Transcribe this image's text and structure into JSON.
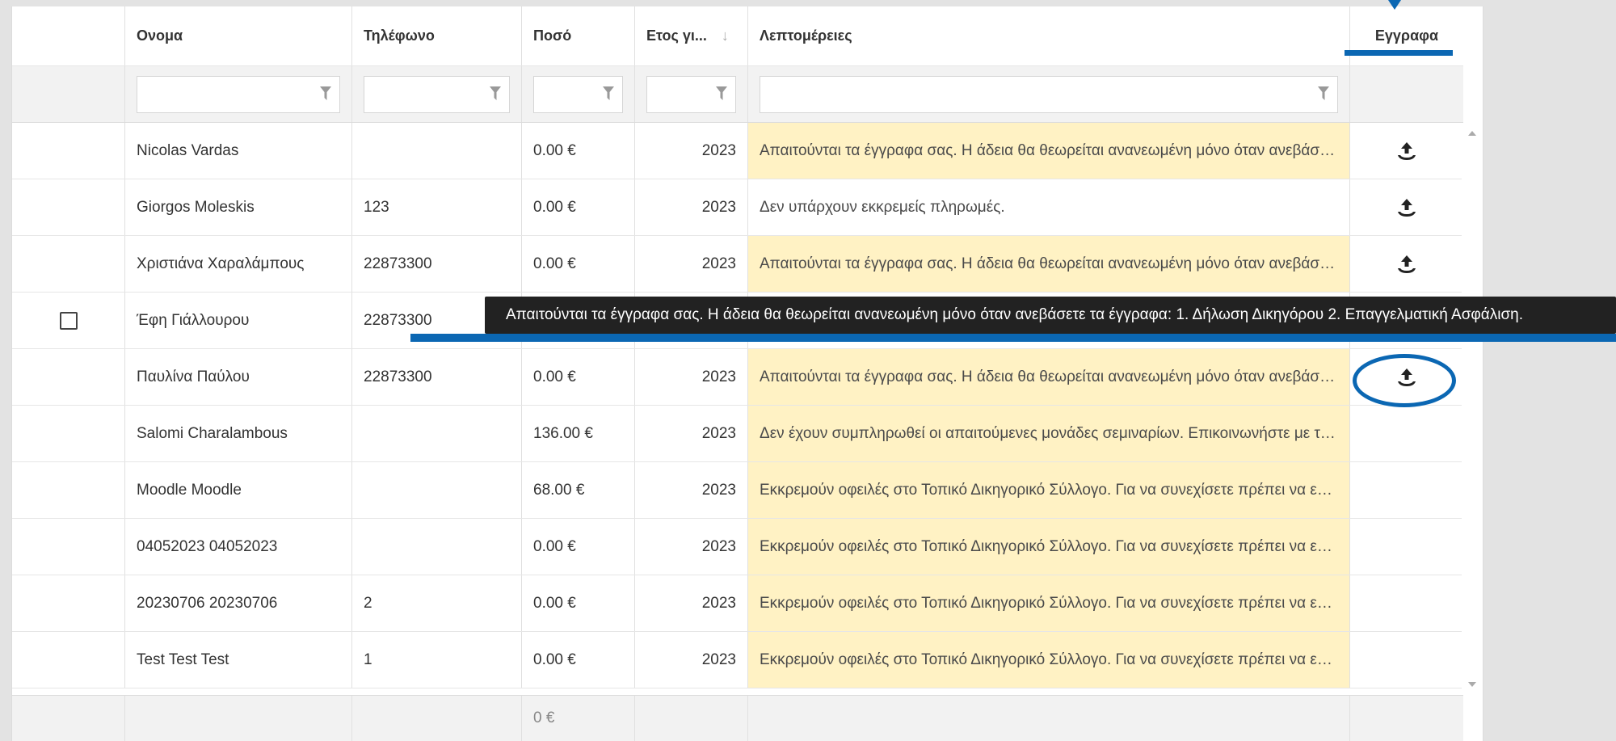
{
  "columns": {
    "name": "Ονομα",
    "phone": "Τηλέφωνο",
    "amount": "Ποσό",
    "year": "Ετος γι...",
    "year_sort": "↓",
    "details": "Λεπτομέρειες",
    "documents": "Εγγραφα"
  },
  "rows": [
    {
      "name": "Nicolas Vardas",
      "phone": "",
      "amount": "0.00 €",
      "year": "2023",
      "details": "Απαιτούνται τα έγγραφα σας. Η άδεια θα θεωρείται ανανεωμένη μόνο όταν ανεβάσετε τα έγγραφα: 1. Δήλωση Δικηγόρου 2. Επαγγελματική Ασφάλιση.",
      "warn": true,
      "upload": true
    },
    {
      "name": "Giorgos Moleskis",
      "phone": "123",
      "amount": "0.00 €",
      "year": "2023",
      "details": "Δεν υπάρχουν εκκρεμείς πληρωμές.",
      "warn": false,
      "upload": true
    },
    {
      "name": "Χριστιάνα Χαραλάμπους",
      "phone": "22873300",
      "amount": "0.00 €",
      "year": "2023",
      "details": "Απαιτούνται τα έγγραφα σας. Η άδεια θα θεωρείται ανανεωμένη μόνο όταν ανεβάσετε τα έγγραφα: 1. Δήλωση Δικηγόρου 2. Επαγγελματική Ασφάλιση.",
      "warn": true,
      "upload": true
    },
    {
      "name": "Έφη Γιάλλουρου",
      "phone": "22873300",
      "amount": "",
      "year": "",
      "details": "",
      "warn": false,
      "upload": false
    },
    {
      "name": "Παυλίνα Παύλου",
      "phone": "22873300",
      "amount": "0.00 €",
      "year": "2023",
      "details": "Απαιτούνται τα έγγραφα σας. Η άδεια θα θεωρείται ανανεωμένη μόνο όταν ανεβάσετε τα έγγραφα: 1. Δήλωση Δικηγόρου 2. Επαγγελματική Ασφάλιση.",
      "warn": true,
      "upload": true
    },
    {
      "name": "Salomi Charalambous",
      "phone": "",
      "amount": "136.00 €",
      "year": "2023",
      "details": "Δεν έχουν συμπληρωθεί οι απαιτούμενες μονάδες σεμιναρίων. Επικοινωνήστε με τον Δικηγορικό Σύλλογο.",
      "warn": true,
      "upload": false
    },
    {
      "name": "Moodle Moodle",
      "phone": "",
      "amount": "68.00 €",
      "year": "2023",
      "details": "Εκκρεμούν οφειλές στο Τοπικό Δικηγορικό Σύλλογο. Για να συνεχίσετε πρέπει να εξοφλήσετε τις οφειλές.",
      "warn": true,
      "upload": false
    },
    {
      "name": "04052023 04052023",
      "phone": "",
      "amount": "0.00 €",
      "year": "2023",
      "details": "Εκκρεμούν οφειλές στο Τοπικό Δικηγορικό Σύλλογο. Για να συνεχίσετε πρέπει να εξοφλήσετε τις οφειλές.",
      "warn": true,
      "upload": false
    },
    {
      "name": "20230706 20230706",
      "phone": "2",
      "amount": "0.00 €",
      "year": "2023",
      "details": "Εκκρεμούν οφειλές στο Τοπικό Δικηγορικό Σύλλογο. Για να συνεχίσετε πρέπει να εξοφλήσετε τις οφειλές.",
      "warn": true,
      "upload": false
    },
    {
      "name": "Test Test Test",
      "phone": "1",
      "amount": "0.00 €",
      "year": "2023",
      "details": "Εκκρεμούν οφειλές στο Τοπικό Δικηγορικό Σύλλογο. Για να συνεχίσετε πρέπει να εξοφλήσετε τις οφειλές.",
      "warn": true,
      "upload": false
    }
  ],
  "footer": {
    "amount_total": "0 €"
  },
  "tooltip": {
    "text": "Απαιτούνται τα έγγραφα σας. Η άδεια θα θεωρείται ανανεωμένη μόνο όταν ανεβάσετε τα έγγραφα: 1. Δήλωση Δικηγόρου 2. Επαγγελματική Ασφάλιση."
  },
  "icons": {
    "filter": "filter-icon",
    "upload": "upload-icon",
    "checkbox": "checkbox"
  },
  "colors": {
    "warn_bg": "#fff2c4",
    "annotation_blue": "#0b67b3",
    "tooltip_bg": "#222222"
  }
}
